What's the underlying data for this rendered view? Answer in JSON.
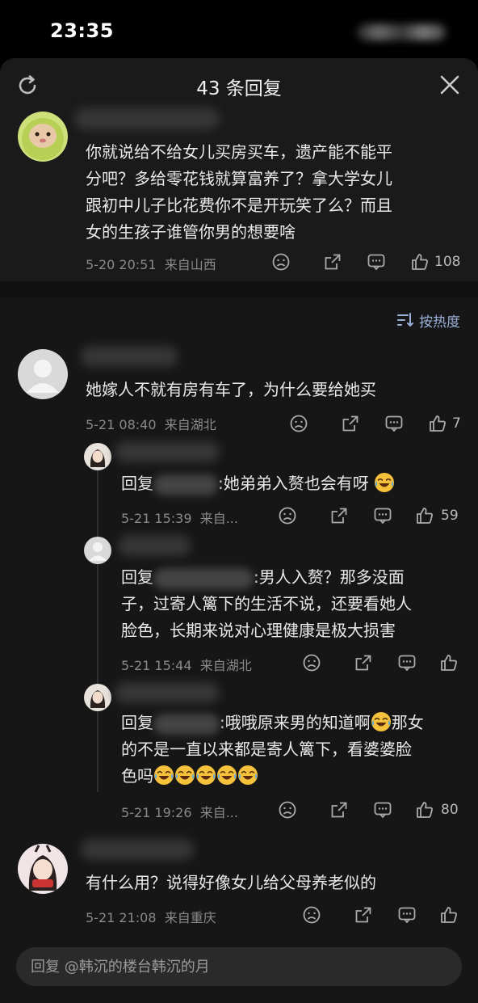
{
  "status": {
    "time": "23:35"
  },
  "header": {
    "title": "43 条回复"
  },
  "sort": {
    "label": "按热度"
  },
  "top_comment": {
    "lines": [
      "你就说给不给女儿买房买车，遗产能不能平",
      "分吧？多给零花钱就算富养了？拿大学女儿",
      "跟初中儿子比花费你不是开玩笑了么？而且",
      "女的生孩子谁管你男的想要啥"
    ],
    "time": "5-20 20:51",
    "location": "来自山西",
    "likes": "108"
  },
  "comments": [
    {
      "text": "她嫁人不就有房有车了，为什么要给她买",
      "time": "5-21 08:40",
      "location": "来自湖北",
      "likes": "7"
    },
    {
      "reply_prefix": "回复",
      "text": ":她弟弟入赘也会有呀",
      "time": "5-21 15:39",
      "location": "来自...",
      "likes": "59"
    },
    {
      "reply_prefix": "回复",
      "lines": [
        ":男人入赘？那多没面",
        "子，过寄人篱下的生活不说，还要看她人",
        "脸色，长期来说对心理健康是极大损害"
      ],
      "time": "5-21 15:44",
      "location": "来自湖北",
      "likes": ""
    },
    {
      "reply_prefix": "回复",
      "lines": [
        ":哦哦原来男的知道啊",
        "那女",
        "的不是一直以来都是寄人篱下，看婆婆脸",
        "色吗"
      ],
      "time": "5-21 19:26",
      "location": "来自...",
      "likes": "80"
    },
    {
      "text": "有什么用？说得好像女儿给父母养老似的",
      "time": "5-21 21:08",
      "location": "来自重庆",
      "likes": ""
    }
  ],
  "input": {
    "placeholder": "回复 @韩沉的楼台韩沉的月"
  },
  "icons": {
    "refresh": "refresh-icon",
    "close": "close-icon",
    "sort": "sort-icon",
    "dislike": "dislike-icon",
    "share": "share-icon",
    "comment": "comment-icon",
    "like": "thumbs-up-icon",
    "emoji": "laughing-tears-emoji"
  }
}
